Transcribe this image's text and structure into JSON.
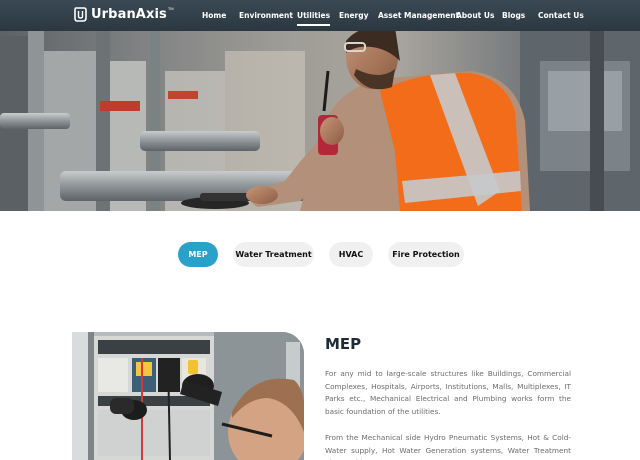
{
  "header": {
    "logo_text": "UrbanAxis",
    "logo_tm": "TM",
    "nav": [
      {
        "label": "Home"
      },
      {
        "label": "Environment"
      },
      {
        "label": "Utilities",
        "active": true
      },
      {
        "label": "Energy"
      },
      {
        "label": "Asset Management"
      },
      {
        "label": "About Us"
      },
      {
        "label": "Blogs"
      },
      {
        "label": "Contact Us"
      }
    ]
  },
  "tabs": [
    {
      "label": "MEP",
      "active": true
    },
    {
      "label": "Water Treatment"
    },
    {
      "label": "HVAC"
    },
    {
      "label": "Fire Protection"
    }
  ],
  "content": {
    "title": "MEP",
    "paragraph1": "For any mid to large-scale structures like Buildings, Commercial Complexes, Hospitals, Airports, Institutions, Malls, Multiplexes, IT Parks etc., Mechanical Electrical and Plumbing works form the basic foundation of the utilities.",
    "paragraph2": "From the Mechanical side Hydro Pneumatic Systems, Hot & Cold-Water supply, Hot Water Generation systems, Water Treatment plants with"
  },
  "colors": {
    "nav_bg": "#2f3d47",
    "accent": "#2aa1c9",
    "tab_bg": "#f0f0f0",
    "title": "#1e2b36",
    "body_text": "#6b6b6b",
    "safety_vest": "#f26c1a"
  }
}
